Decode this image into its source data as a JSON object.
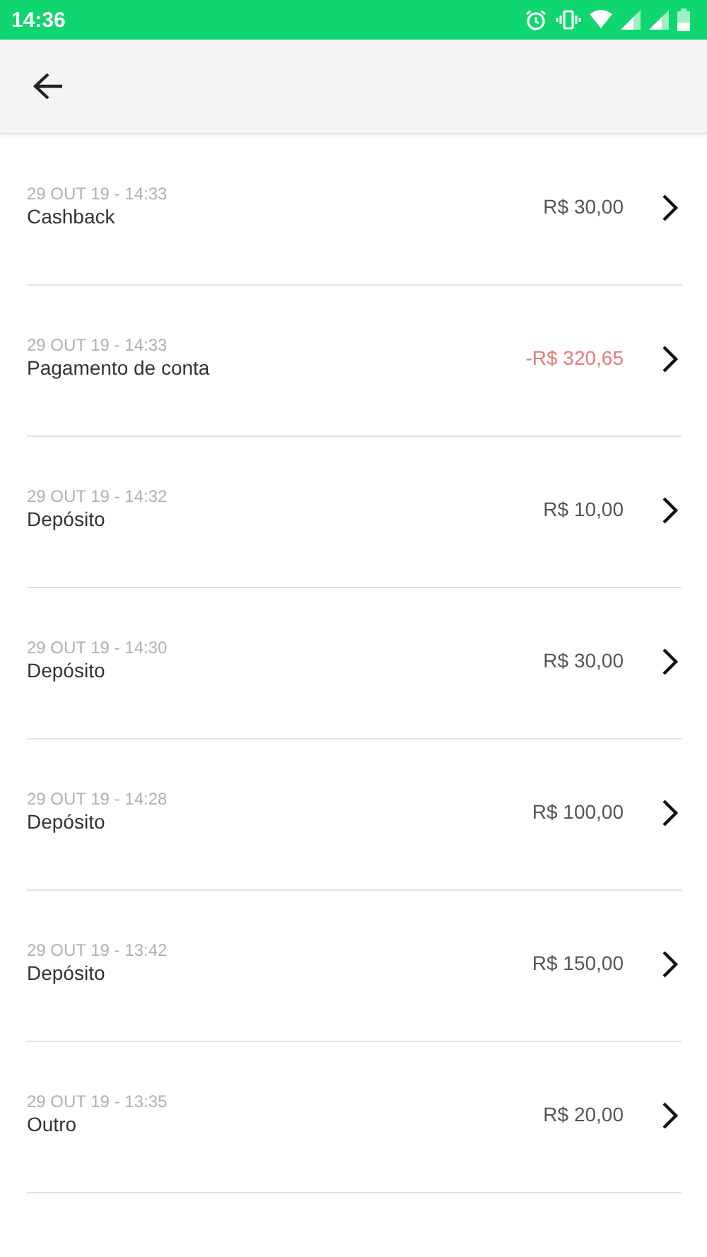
{
  "status_bar": {
    "time": "14:36"
  },
  "transactions": [
    {
      "date": "29 OUT 19 - 14:33",
      "description": "Cashback",
      "amount": "R$ 30,00",
      "kind": "credit"
    },
    {
      "date": "29 OUT 19 - 14:33",
      "description": "Pagamento de conta",
      "amount": "-R$ 320,65",
      "kind": "debit"
    },
    {
      "date": "29 OUT 19 - 14:32",
      "description": "Depósito",
      "amount": "R$ 10,00",
      "kind": "credit"
    },
    {
      "date": "29 OUT 19 - 14:30",
      "description": "Depósito",
      "amount": "R$ 30,00",
      "kind": "credit"
    },
    {
      "date": "29 OUT 19 - 14:28",
      "description": "Depósito",
      "amount": "R$ 100,00",
      "kind": "credit"
    },
    {
      "date": "29 OUT 19 - 13:42",
      "description": "Depósito",
      "amount": "R$ 150,00",
      "kind": "credit"
    },
    {
      "date": "29 OUT 19 - 13:35",
      "description": "Outro",
      "amount": "R$ 20,00",
      "kind": "credit"
    }
  ]
}
